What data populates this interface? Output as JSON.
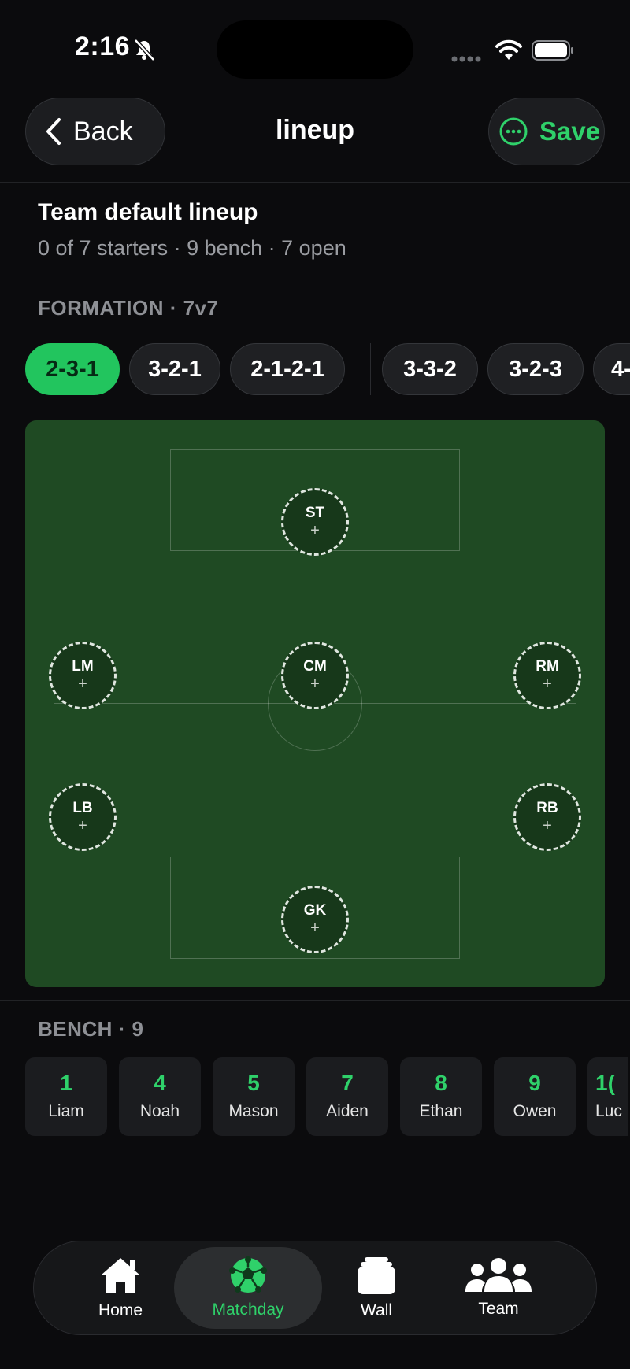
{
  "status_bar": {
    "time": "2:16"
  },
  "nav": {
    "back_label": "Back",
    "title": "lineup",
    "save_label": "Save"
  },
  "lineup": {
    "title": "Team default lineup",
    "summary": "0 of 7 starters · 9 bench · 7 open"
  },
  "formation": {
    "label": "FORMATION · 7v7",
    "options": [
      "2-3-1",
      "3-2-1",
      "2-1-2-1",
      "3-3-2",
      "3-2-3",
      "4-"
    ],
    "selected": "2-3-1"
  },
  "pitch": {
    "positions": [
      {
        "code": "ST",
        "plus": "+"
      },
      {
        "code": "LM",
        "plus": "+"
      },
      {
        "code": "CM",
        "plus": "+"
      },
      {
        "code": "RM",
        "plus": "+"
      },
      {
        "code": "LB",
        "plus": "+"
      },
      {
        "code": "RB",
        "plus": "+"
      },
      {
        "code": "GK",
        "plus": "+"
      }
    ]
  },
  "bench": {
    "label": "BENCH · 9",
    "players": [
      {
        "number": "1",
        "name": "Liam"
      },
      {
        "number": "4",
        "name": "Noah"
      },
      {
        "number": "5",
        "name": "Mason"
      },
      {
        "number": "7",
        "name": "Aiden"
      },
      {
        "number": "8",
        "name": "Ethan"
      },
      {
        "number": "9",
        "name": "Owen"
      },
      {
        "number": "1(",
        "name": "Luc"
      }
    ]
  },
  "tabbar": {
    "tabs": [
      {
        "label": "Home",
        "icon": "home-icon"
      },
      {
        "label": "Matchday",
        "icon": "soccer-ball-icon"
      },
      {
        "label": "Wall",
        "icon": "stack-icon"
      },
      {
        "label": "Team",
        "icon": "team-icon"
      }
    ],
    "active": "Matchday"
  },
  "colors": {
    "accent": "#22c55e",
    "pitch": "#1f4a23",
    "background": "#0b0b0d"
  }
}
